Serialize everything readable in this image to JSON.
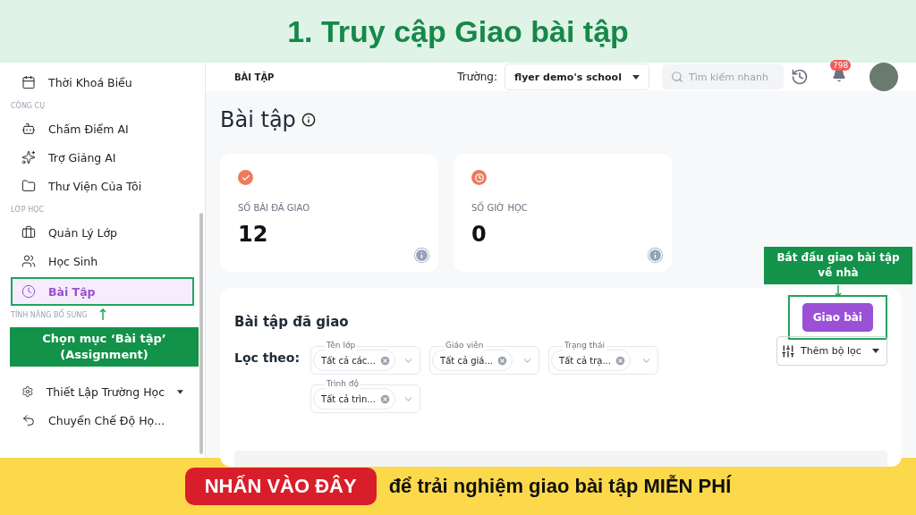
{
  "banner": {
    "title": "1. Truy cập Giao bài tập"
  },
  "sidebar": {
    "entries": [
      {
        "kind": "item",
        "label": "Thời Khoá Biểu",
        "selected": false
      },
      {
        "kind": "section",
        "label": "CÔNG CỤ"
      },
      {
        "kind": "item",
        "label": "Chấm Điểm AI",
        "selected": false
      },
      {
        "kind": "item",
        "label": "Trợ Giảng AI",
        "selected": false
      },
      {
        "kind": "item",
        "label": "Thư Viện Của Tôi",
        "selected": false
      },
      {
        "kind": "section",
        "label": "LỚP HỌC"
      },
      {
        "kind": "item",
        "label": "Quản Lý Lớp",
        "selected": false
      },
      {
        "kind": "item",
        "label": "Học Sinh",
        "selected": false
      },
      {
        "kind": "item",
        "label": "Bài Tập",
        "selected": true
      },
      {
        "kind": "section",
        "label": "TÍNH NĂNG BỔ SUNG"
      },
      {
        "kind": "callout",
        "lines": [
          "Chọn mục ‘Bài tập’",
          "(Assignment)"
        ]
      },
      {
        "kind": "item",
        "label": "Thiết Lập Trường Học",
        "selected": false,
        "caret": true
      },
      {
        "kind": "item",
        "label": "Chuyển Chế Độ Họ...",
        "selected": false
      }
    ]
  },
  "topbar": {
    "breadcrumb": "BÀI TẬP",
    "school_label": "Trường:",
    "school": "flyer demo's school",
    "search": {
      "placeholder": "Tìm kiếm nhanh"
    },
    "notifications": "798"
  },
  "page": {
    "title": "Bài tập",
    "stats": [
      {
        "label": "SỐ BÀI ĐÃ GIAO",
        "value": "12",
        "kind": "check"
      },
      {
        "label": "SỐ GIỜ HỌC",
        "value": "0",
        "kind": "clock"
      }
    ],
    "callout": {
      "lines": [
        "Bắt đầu giao bài tập",
        "về nhà"
      ]
    },
    "section": {
      "title": "Bài tập đã giao",
      "button": "Giao bài",
      "filter_label": "Lọc theo:",
      "more_filters": "Thêm bộ lọc",
      "filters": [
        {
          "label": "Tên lớp",
          "value": "Tất cả các..."
        },
        {
          "label": "Giáo viên",
          "value": "Tất cả giá..."
        },
        {
          "label": "Trạng thái",
          "value": "Tất cả trạ..."
        },
        {
          "label": "Trình độ",
          "value": "Tất cả trìn..."
        }
      ]
    }
  },
  "footer": {
    "button": "NHẤN VÀO ĐÂY",
    "text": "để trải nghiệm giao bài tập MIỄN PHÍ"
  }
}
